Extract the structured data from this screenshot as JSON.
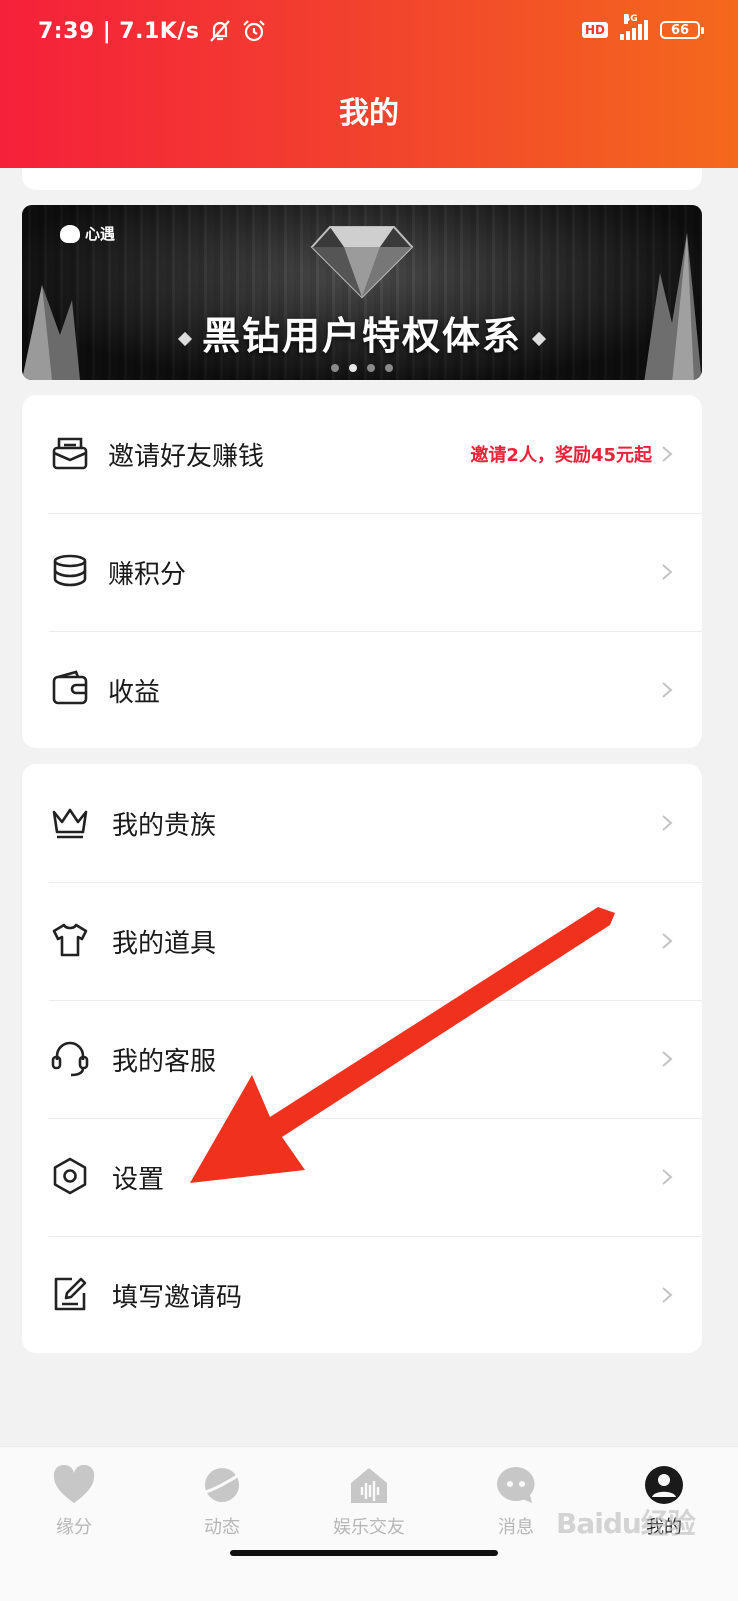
{
  "status_bar": {
    "time": "7:39",
    "net_speed": "7.1K/s",
    "hd": "HD",
    "network": "4G",
    "battery": "66"
  },
  "header": {
    "title": "我的"
  },
  "banner": {
    "logo_text": "心遇",
    "title": "黑钻用户特权体系",
    "dots": 4,
    "active_dot": 2
  },
  "menu_group_1": [
    {
      "label": "邀请好友赚钱",
      "icon": "invite-envelope-icon",
      "extra": "邀请2人，奖励45元起"
    },
    {
      "label": "赚积分",
      "icon": "coins-stack-icon",
      "extra": ""
    },
    {
      "label": "收益",
      "icon": "wallet-icon",
      "extra": ""
    }
  ],
  "menu_group_2": [
    {
      "label": "我的贵族",
      "icon": "crown-icon"
    },
    {
      "label": "我的道具",
      "icon": "tshirt-icon"
    },
    {
      "label": "我的客服",
      "icon": "headset-icon"
    },
    {
      "label": "设置",
      "icon": "hexagon-settings-icon"
    },
    {
      "label": "填写邀请码",
      "icon": "edit-note-icon"
    }
  ],
  "annotation": {
    "type": "red-arrow",
    "points_to": "设置"
  },
  "tabbar": {
    "items": [
      {
        "label": "缘分",
        "icon": "heart-icon",
        "active": false
      },
      {
        "label": "动态",
        "icon": "planet-icon",
        "active": false
      },
      {
        "label": "娱乐交友",
        "icon": "home-voice-icon",
        "active": false
      },
      {
        "label": "消息",
        "icon": "chat-bubble-icon",
        "active": false
      },
      {
        "label": "我的",
        "icon": "user-icon",
        "active": true
      }
    ]
  },
  "watermark": "Baidu经验",
  "colors": {
    "header_start": "#f5203a",
    "header_end": "#f4691c",
    "accent_red": "#e8233a",
    "arrow_red": "#f0311e",
    "inactive_tab": "#b7b7b7"
  }
}
